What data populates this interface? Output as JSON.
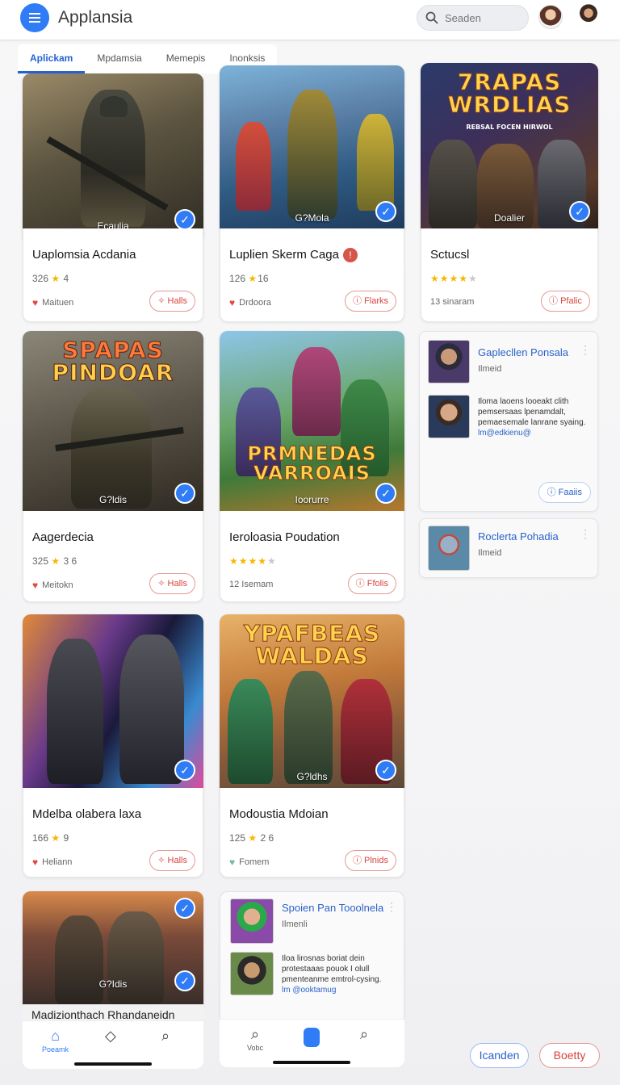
{
  "header": {
    "title": "Applansia",
    "search_placeholder": "Seaden"
  },
  "tabs": [
    "Aplickam",
    "Mpdamsia",
    "Memepis",
    "Inonksis"
  ],
  "games": [
    {
      "title": "Uaplomsia Acdania",
      "thumb_label": "Ecaulia",
      "rating_count": "326",
      "rating_value": "4",
      "meta": "Maituen",
      "action": "Halls"
    },
    {
      "title": "Luplien Skerm Caga",
      "thumb_label": "G?Mola",
      "rating_count": "126",
      "rating_value": "16",
      "meta": "Drdoora",
      "action": "Flarks"
    },
    {
      "title": "Sctucsl",
      "thumb_label": "Doalier",
      "logo_line1": "7RAPAS",
      "logo_line2": "WRDLIAS",
      "logo_small": "REBSAL FOCEN HIRWOL",
      "stars_on": 4,
      "meta": "13 sinaram",
      "action": "Pfalic"
    },
    {
      "title": "Aagerdecia",
      "thumb_label": "G?ldis",
      "logo_line1": "SPAPAS",
      "logo_line2": "PINDOAR",
      "rating_count": "325",
      "rating_value": "3 6",
      "meta": "Meitokn",
      "action": "Halls"
    },
    {
      "title": "Ieroloasia Poudation",
      "thumb_label": "Ioorurre",
      "logo_line1": "PRMNEDAS",
      "logo_line2": "VARROAIS",
      "stars_on": 4,
      "meta": "12 Isemam",
      "action": "Ffolis"
    },
    {
      "title": "Mdelba olabera laxa",
      "thumb_label": "",
      "rating_count": "166",
      "rating_value": "9",
      "meta": "Heliann",
      "action": "Halls"
    },
    {
      "title": "Modoustia Mdoian",
      "thumb_label": "G?ldhs",
      "logo_line1": "YPAFBEAS",
      "logo_line2": "WALDAS",
      "rating_count": "125",
      "rating_value": "2 6",
      "meta": "Fomem",
      "action": "Plnids"
    },
    {
      "title": "Madizionthach Rhandaneidn",
      "thumb_label": "G?Idis"
    }
  ],
  "profiles": [
    {
      "name": "Gaplecllen Ponsala",
      "sub": "Ilmeid",
      "body": "Iloma laoens looeakt clith pemsersaas lpenamdalt, pemaesemale lanrane syaing.",
      "link": "lm@edkienu@",
      "button": "Faaiis"
    },
    {
      "name": "Roclerta Pohadia",
      "sub": "Ilmeid"
    },
    {
      "name": "Spoien Pan Tooolnela",
      "sub": "Ilmenli",
      "body": "Iloa lirosnas boriat dein protestaaas pouok I olull pmenteanme emtrol-cysing.",
      "link": "lm @ooktamug"
    }
  ],
  "bottom_nav": {
    "left": [
      "Poeamk",
      "",
      ""
    ],
    "right": [
      "Vobc",
      "",
      ""
    ]
  },
  "footer": {
    "left_button": "Icanden",
    "right_button": "Boetty"
  },
  "colors": {
    "accent": "#2f7cf6",
    "danger": "#d9443c",
    "link": "#2a62c9"
  }
}
